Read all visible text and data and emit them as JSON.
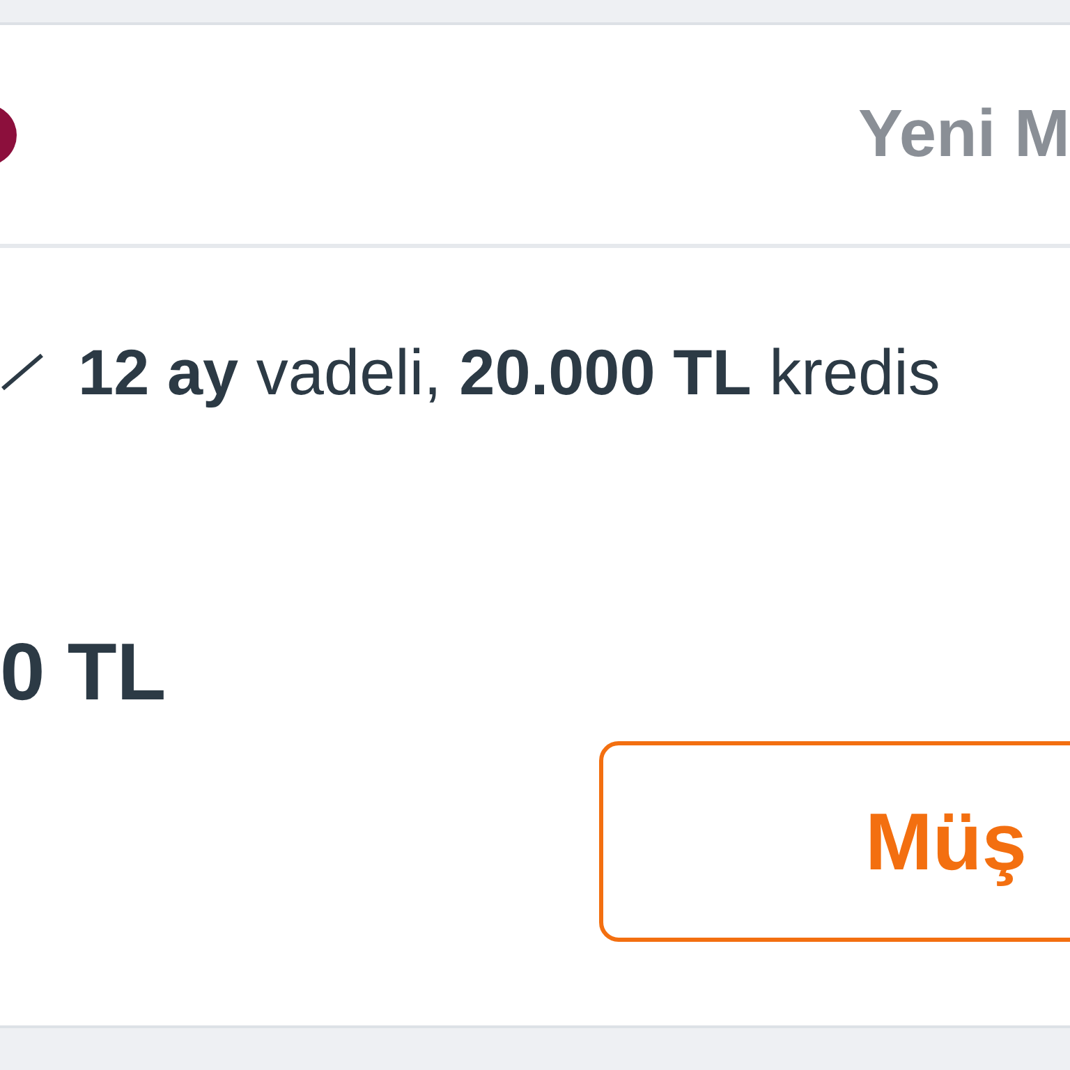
{
  "header": {
    "brand_dot": {
      "color": "#8c0f3c"
    },
    "title": "Yeni M"
  },
  "offer": {
    "text": "**12 ay** vadeli, **20.000 TL** kredis"
  },
  "amount": "0 TL",
  "button": {
    "label": "Müş"
  }
}
